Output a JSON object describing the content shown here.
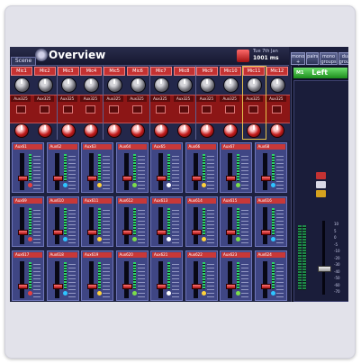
{
  "topbar": {
    "button_label": "Scene",
    "title": "Overview",
    "info_line1": "Tue 7th Jan",
    "info_line2": "1001 ms"
  },
  "right_buttons": [
    "mono + pairs",
    "pairs",
    "mono groups",
    "dual groups"
  ],
  "right_panel": {
    "tag": "M1",
    "title": "Left",
    "scale": [
      "10",
      "5",
      "0",
      "-5",
      "-10",
      "-20",
      "-30",
      "-40",
      "-50",
      "-60",
      "-70"
    ]
  },
  "channels": [
    {
      "label": "Mic1",
      "aux": "Aux325"
    },
    {
      "label": "Mic2",
      "aux": "Aux325"
    },
    {
      "label": "Mic3",
      "aux": "Aux325"
    },
    {
      "label": "Mic4",
      "aux": "Aux325"
    },
    {
      "label": "Mic5",
      "aux": "Aux325"
    },
    {
      "label": "Mic6",
      "aux": "Aux325"
    },
    {
      "label": "Mic7",
      "aux": "Aux325"
    },
    {
      "label": "Mic8",
      "aux": "Aux325"
    },
    {
      "label": "Mic9",
      "aux": "Aux325"
    },
    {
      "label": "Mic10",
      "aux": "Aux325"
    },
    {
      "label": "Mic11",
      "aux": "Aux325"
    },
    {
      "label": "Mic12",
      "aux": "Aux325"
    }
  ],
  "aux_rows": [
    [
      "Aux61",
      "Aux62",
      "Aux63",
      "Aux64",
      "Aux65",
      "Aux66",
      "Aux67",
      "Aux68"
    ],
    [
      "Aux69",
      "Aux610",
      "Aux611",
      "Aux612",
      "Aux613",
      "Aux614",
      "Aux615",
      "Aux616"
    ],
    [
      "Aux617",
      "Aux618",
      "Aux619",
      "Aux620",
      "Aux621",
      "Aux622",
      "Aux623",
      "Aux624"
    ]
  ],
  "aux_dot_colors": [
    "#e64040",
    "#2ec4ff",
    "#ffd23a",
    "#7bdc4a",
    "#ffffff",
    "#ffd23a",
    "#7bdc4a",
    "#2ec4ff"
  ],
  "colors": {
    "accent_red": "#c43232",
    "panel_blue": "#3f4684",
    "green": "#1c8c1c"
  }
}
